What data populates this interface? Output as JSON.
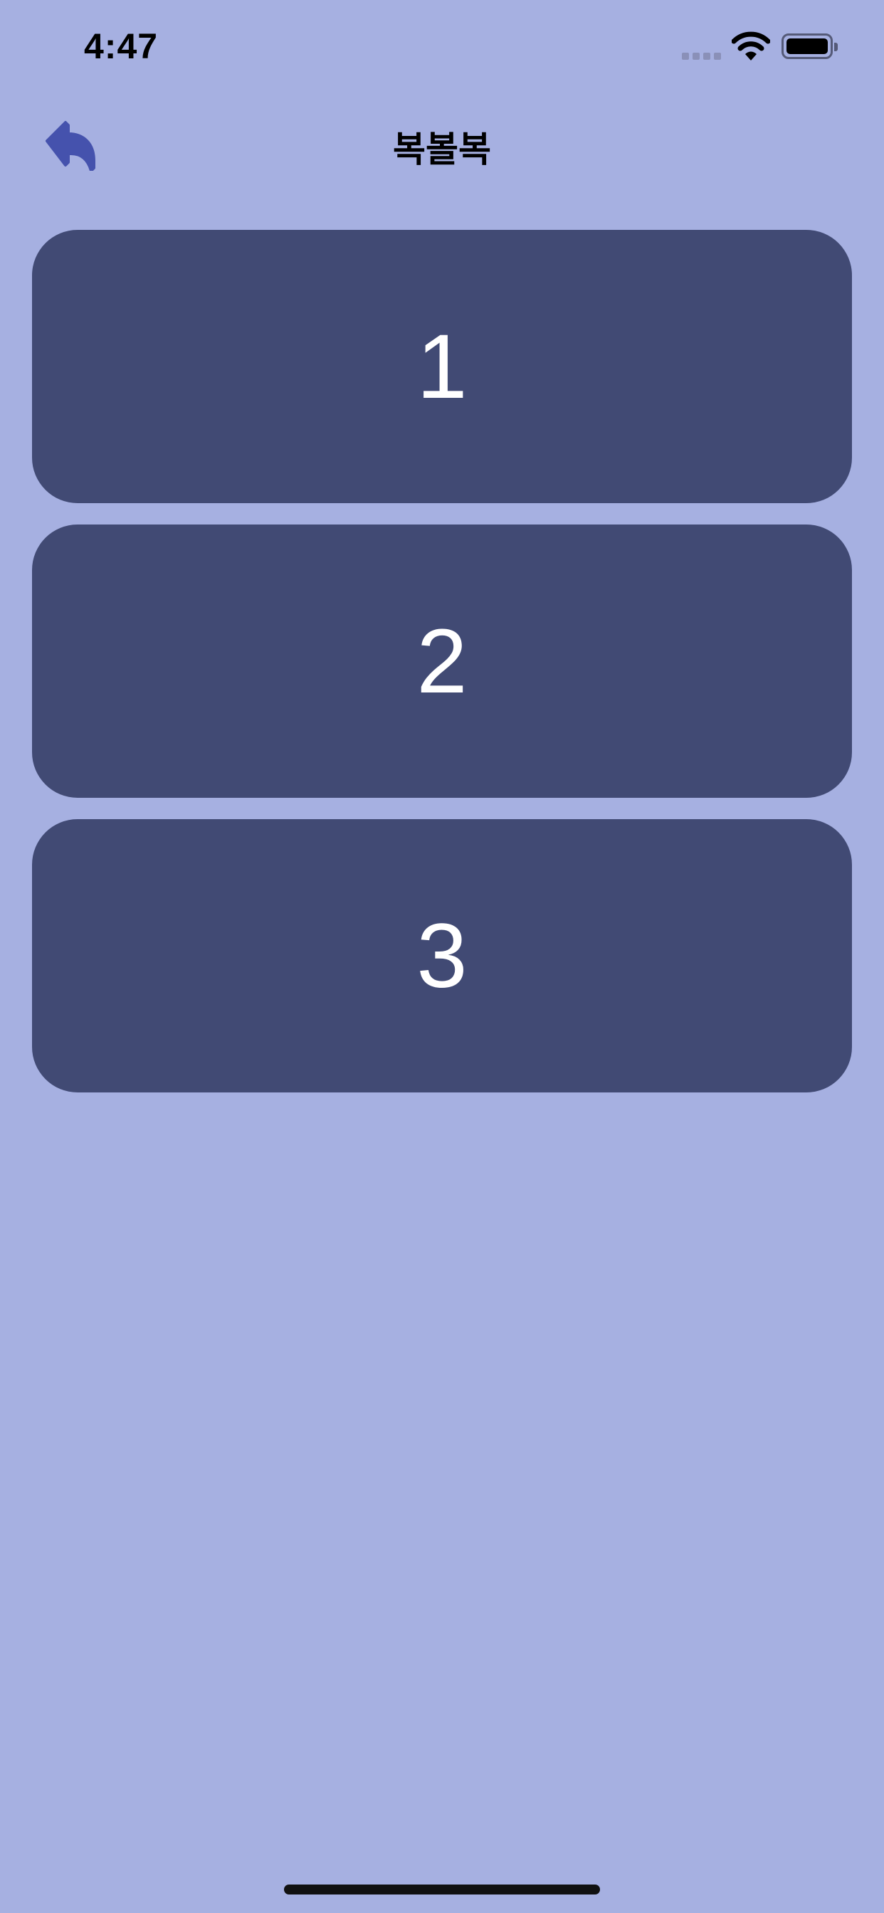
{
  "status_bar": {
    "time": "4:47",
    "icons": [
      "signal-dots-icon",
      "wifi-icon",
      "battery-icon"
    ]
  },
  "nav": {
    "back_icon": "back-arrow-icon",
    "title": "복볼복"
  },
  "cards": [
    {
      "label": "1"
    },
    {
      "label": "2"
    },
    {
      "label": "3"
    }
  ],
  "colors": {
    "background": "#a6b0e1",
    "card": "#414a74",
    "card_text": "#ffffff",
    "back_icon": "#4552ad"
  }
}
